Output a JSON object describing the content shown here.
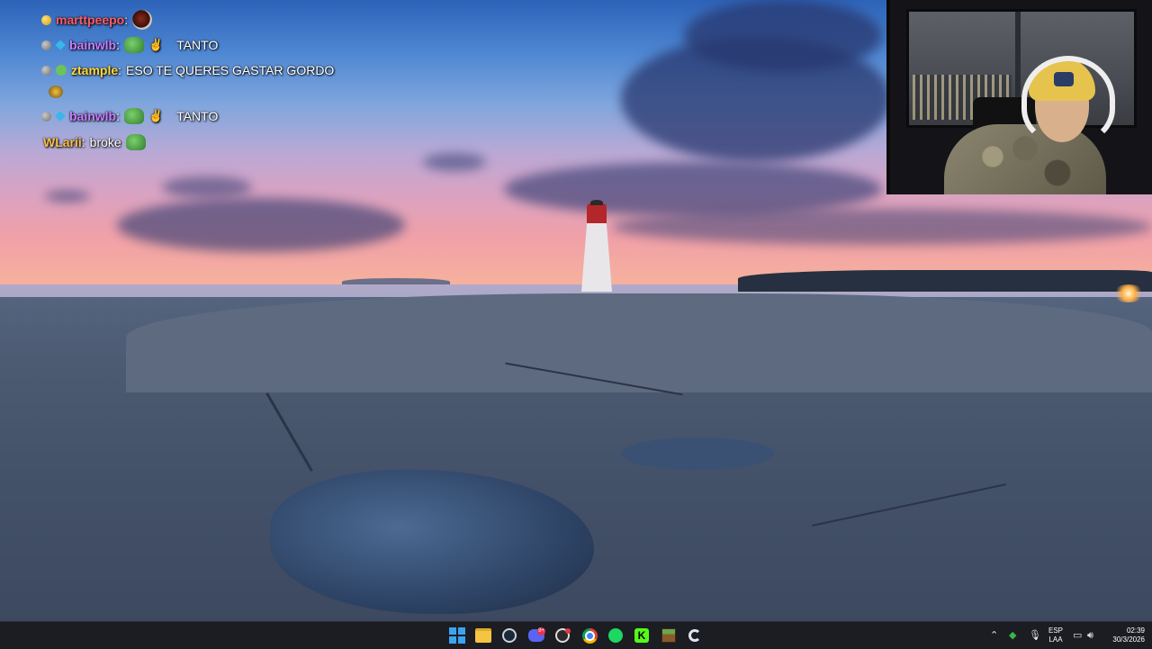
{
  "chat": {
    "messages": [
      {
        "user": "marttpeepo",
        "text": "",
        "badges": [
          "gold-badge"
        ],
        "emotes": [
          "dark-emote"
        ]
      },
      {
        "user": "bainwlb",
        "text": "TANTO",
        "badges": [
          "gray-badge",
          "cube-badge"
        ],
        "emotes": [
          "pepe-emote",
          "hand-emote"
        ]
      },
      {
        "user": "ztample",
        "text": "ESO TE QUERES GASTAR GORDO",
        "badges": [
          "gray-badge",
          "frog-badge"
        ],
        "emotes": []
      },
      {
        "user": "bainwlb",
        "text": "TANTO",
        "badges": [
          "gray-badge",
          "cube-badge"
        ],
        "emotes": [
          "pepe-emote",
          "hand-emote"
        ]
      },
      {
        "user": "WLarii",
        "text": "broke",
        "badges": [],
        "emotes": [
          "pepe-emote"
        ]
      }
    ],
    "separator": ":"
  },
  "taskbar": {
    "apps": [
      "start-icon",
      "file-explorer-icon",
      "steam-icon",
      "discord-icon",
      "obs-icon",
      "chrome-icon",
      "spotify-icon",
      "kick-icon",
      "minecraft-icon",
      "ccleaner-icon"
    ],
    "discord_notification": "9+",
    "language": "ESP",
    "layout": "LAA",
    "time": "02:39",
    "date": "30/3/2026",
    "tray": [
      "chevron-up-icon",
      "shield-icon",
      "mic-icon",
      "network-icon",
      "speaker-icon",
      "battery-icon"
    ]
  },
  "colors": {
    "taskbar": "#1c1d22",
    "username_violet": "#c77dff",
    "username_red": "#ff5b67",
    "username_yellow": "#ffd93b",
    "username_orange": "#f5c04a"
  }
}
